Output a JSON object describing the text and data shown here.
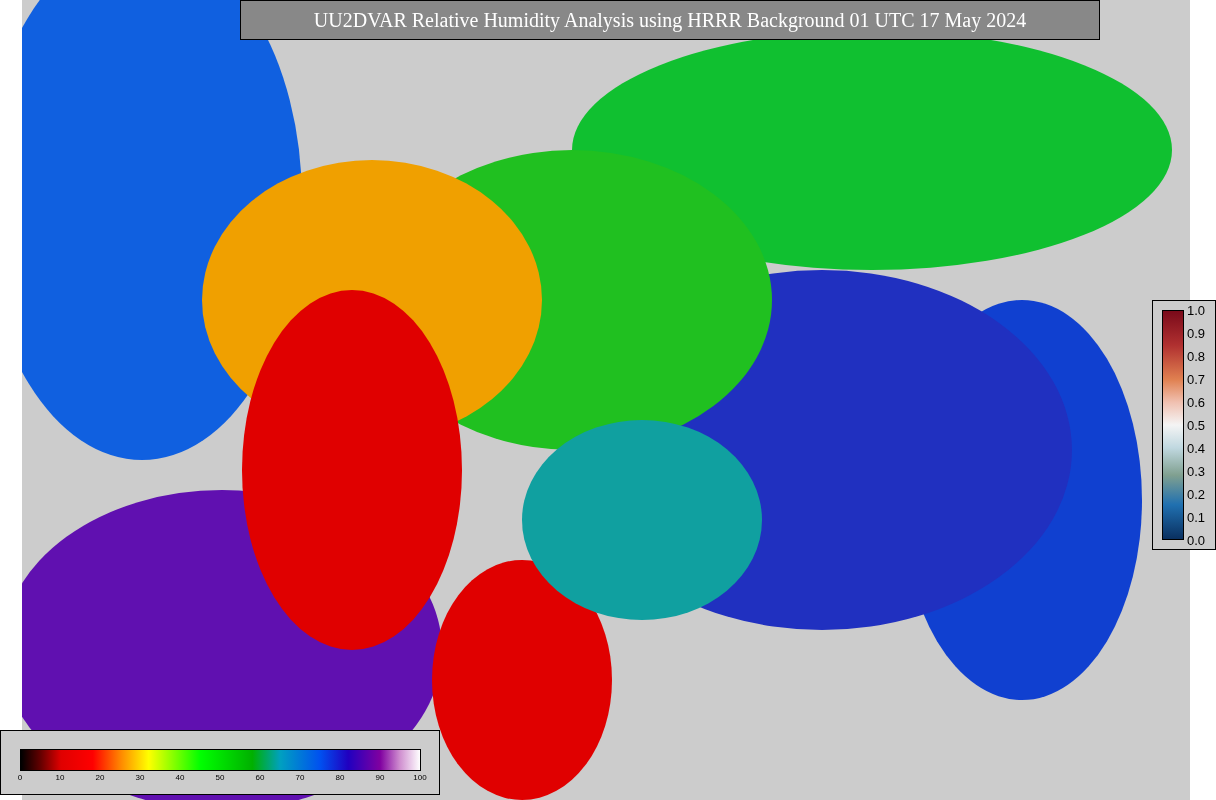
{
  "title": "UU2DVAR Relative Humidity Analysis using HRRR Background 01 UTC 17 May 2024",
  "colorbars": [
    {
      "kind": "horizontal",
      "ticks": [
        "0",
        "10",
        "20",
        "30",
        "40",
        "50",
        "60",
        "70",
        "80",
        "90",
        "100"
      ]
    },
    {
      "kind": "vertical",
      "ticks": [
        "1.0",
        "0.9",
        "0.8",
        "0.7",
        "0.6",
        "0.5",
        "0.4",
        "0.3",
        "0.2",
        "0.1",
        "0.0"
      ]
    }
  ]
}
